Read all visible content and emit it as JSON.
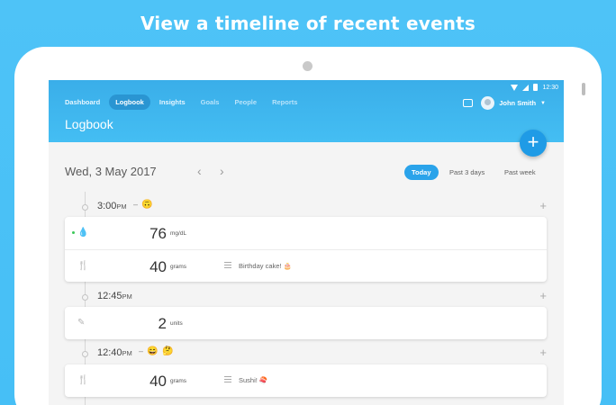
{
  "headline": "View a timeline of recent events",
  "status_bar": {
    "time": "12:30"
  },
  "nav": {
    "items": [
      {
        "label": "Dashboard",
        "state": "normal"
      },
      {
        "label": "Logbook",
        "state": "active"
      },
      {
        "label": "Insights",
        "state": "normal"
      },
      {
        "label": "Goals",
        "state": "faded"
      },
      {
        "label": "People",
        "state": "faded"
      },
      {
        "label": "Reports",
        "state": "faded"
      }
    ]
  },
  "user": {
    "name": "John Smith"
  },
  "page_title": "Logbook",
  "fab_label": "+",
  "date_bar": {
    "date": "Wed, 3 May 2017",
    "prev": "‹",
    "next": "›",
    "filters": [
      "Today",
      "Past 3 days",
      "Past week"
    ],
    "active_filter": "Today"
  },
  "groups": [
    {
      "time": "3:00",
      "ampm": "PM",
      "separator": "–",
      "emojis": [
        "🙃"
      ],
      "add": "+",
      "entries": [
        {
          "icon": "droplet-icon",
          "glyph": "💧",
          "value": "76",
          "unit": "mg/dL",
          "note": "",
          "indicator": "green"
        },
        {
          "icon": "fork-knife-icon",
          "glyph": "🍴",
          "value": "40",
          "unit": "grams",
          "note": "Birthday cake! 🎂"
        }
      ]
    },
    {
      "time": "12:45",
      "ampm": "PM",
      "separator": "",
      "emojis": [],
      "add": "+",
      "entries": [
        {
          "icon": "syringe-icon",
          "glyph": "✎",
          "value": "2",
          "unit": "units",
          "note": ""
        }
      ]
    },
    {
      "time": "12:40",
      "ampm": "PM",
      "separator": "–",
      "emojis": [
        "😄",
        "🤔"
      ],
      "add": "+",
      "entries": [
        {
          "icon": "fork-knife-icon",
          "glyph": "🍴",
          "value": "40",
          "unit": "grams",
          "note": "Sushi! 🍣"
        }
      ]
    }
  ],
  "colors": {
    "background": "#4ec3f7",
    "app_bar": "#44bef3",
    "accent": "#1f9be6",
    "status_green": "#3cc85a"
  }
}
